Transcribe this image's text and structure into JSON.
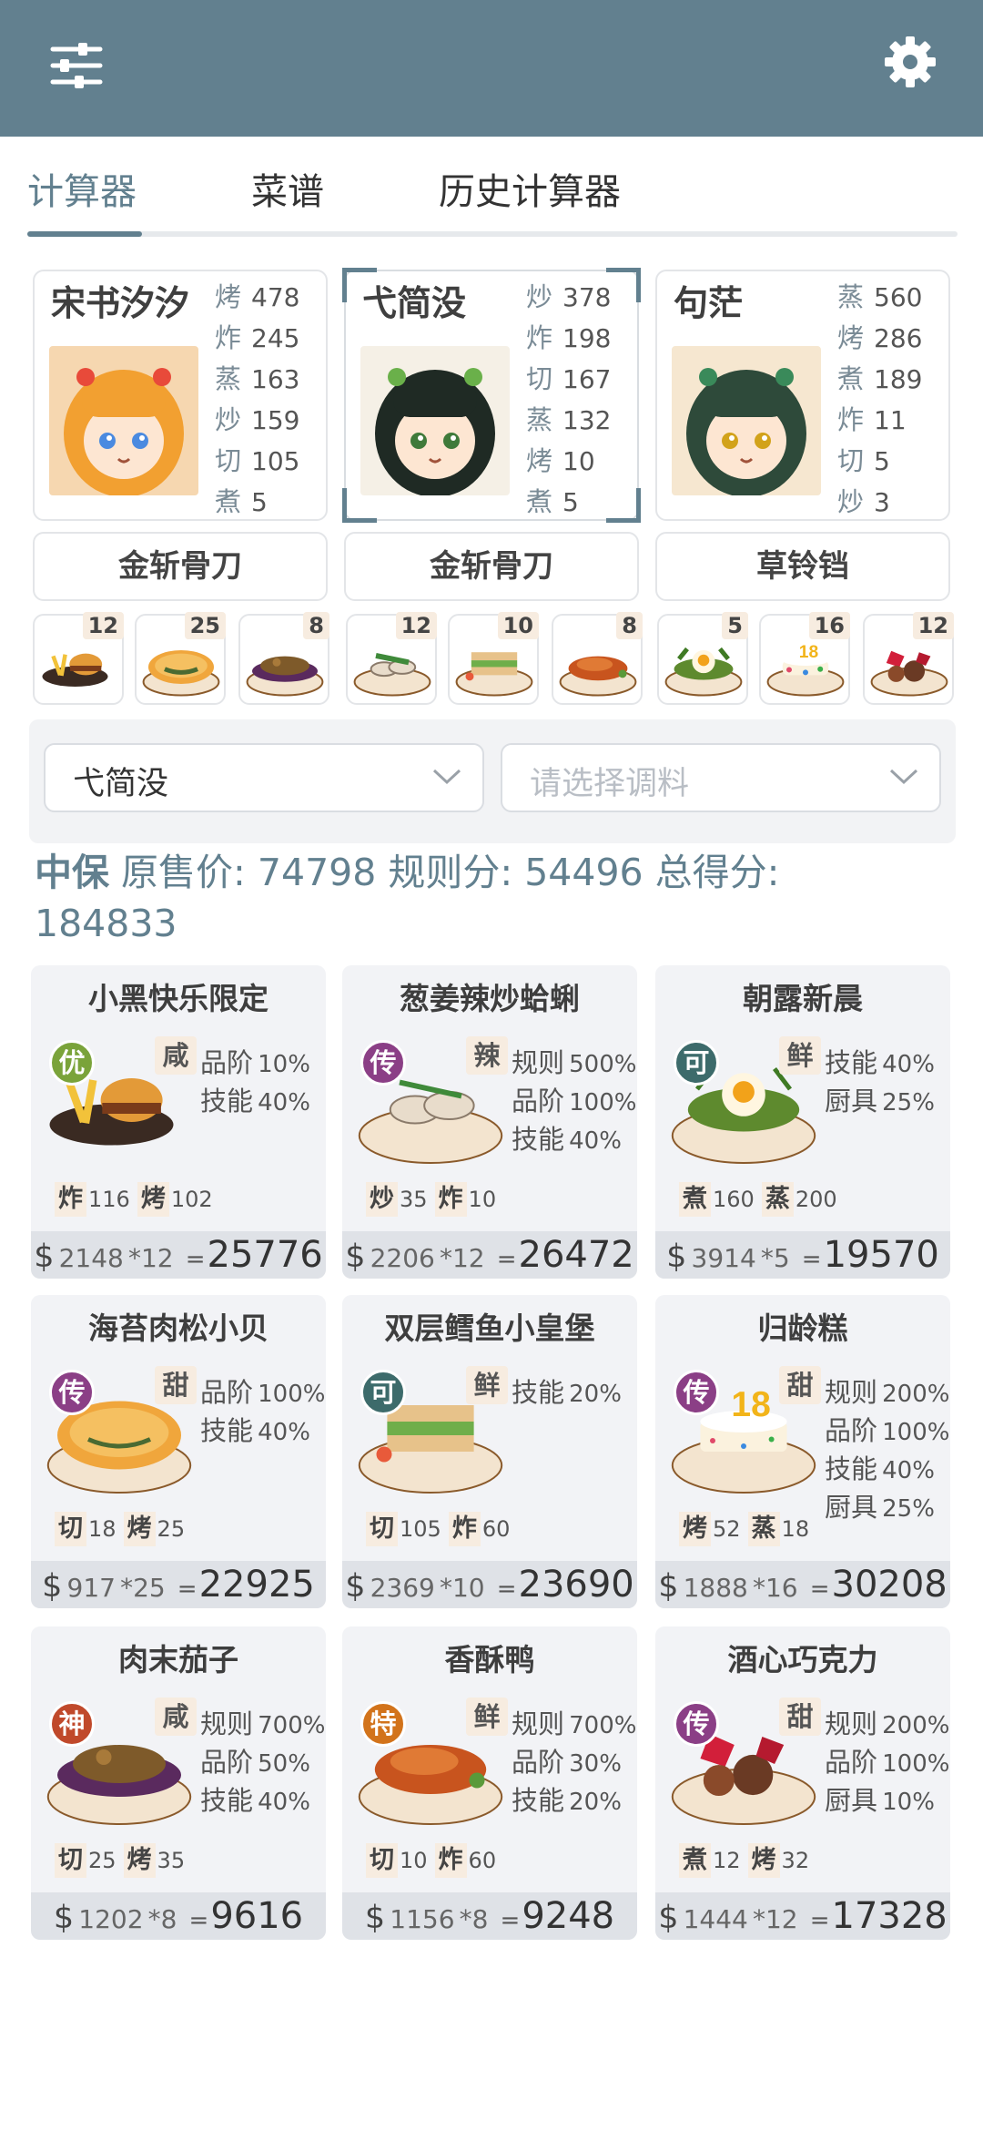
{
  "header": {
    "menu_icon": "sliders-icon",
    "settings_icon": "gear-icon",
    "bg_color": "#62808f"
  },
  "tabs": [
    {
      "label": "计算器",
      "active": true
    },
    {
      "label": "菜谱",
      "active": false
    },
    {
      "label": "历史计算器",
      "active": false
    }
  ],
  "chefs": [
    {
      "name": "宋书汐汐",
      "selected": false,
      "stats": [
        {
          "k": "烤",
          "v": "478"
        },
        {
          "k": "炸",
          "v": "245"
        },
        {
          "k": "蒸",
          "v": "163"
        },
        {
          "k": "炒",
          "v": "159"
        },
        {
          "k": "切",
          "v": "105"
        },
        {
          "k": "煮",
          "v": "5"
        }
      ],
      "tool": "金斩骨刀"
    },
    {
      "name": "弋简没",
      "selected": true,
      "stats": [
        {
          "k": "炒",
          "v": "378"
        },
        {
          "k": "炸",
          "v": "198"
        },
        {
          "k": "切",
          "v": "167"
        },
        {
          "k": "蒸",
          "v": "132"
        },
        {
          "k": "烤",
          "v": "10"
        },
        {
          "k": "煮",
          "v": "5"
        }
      ],
      "tool": "金斩骨刀"
    },
    {
      "name": "句茫",
      "selected": false,
      "stats": [
        {
          "k": "蒸",
          "v": "560"
        },
        {
          "k": "烤",
          "v": "286"
        },
        {
          "k": "煮",
          "v": "189"
        },
        {
          "k": "炸",
          "v": "11"
        },
        {
          "k": "切",
          "v": "5"
        },
        {
          "k": "炒",
          "v": "3"
        }
      ],
      "tool": "草铃铛"
    }
  ],
  "recipe_thumbs": [
    {
      "qty": "12",
      "icon": "burger-fries-icon"
    },
    {
      "qty": "25",
      "icon": "seaweed-shell-icon"
    },
    {
      "qty": "8",
      "icon": "eggplant-icon"
    },
    {
      "qty": "12",
      "icon": "clam-stirfry-icon"
    },
    {
      "qty": "10",
      "icon": "sandwich-icon"
    },
    {
      "qty": "8",
      "icon": "roast-duck-icon"
    },
    {
      "qty": "5",
      "icon": "salad-egg-icon"
    },
    {
      "qty": "16",
      "icon": "birthday-cake-icon"
    },
    {
      "qty": "12",
      "icon": "chocolate-icon"
    }
  ],
  "selects": {
    "chef_value": "弋简没",
    "seasoning_placeholder": "请选择调料"
  },
  "summary": {
    "tier": "中保",
    "line": "原售价: 74798 规则分: 54496 总得分:",
    "total": "184833"
  },
  "dishes": [
    {
      "name": "小黑快乐限定",
      "rarity": "优",
      "rarity_color": "#7aa33a",
      "flavor": "咸",
      "bonuses": [
        {
          "k": "品阶",
          "v": "10%"
        },
        {
          "k": "技能",
          "v": "40%"
        }
      ],
      "reqs": [
        {
          "k": "炸",
          "v": "116"
        },
        {
          "k": "烤",
          "v": "102"
        }
      ],
      "price": "2148",
      "mult": "*12",
      "total": "25776",
      "art": "burger-fries-icon"
    },
    {
      "name": "葱姜辣炒蛤蜊",
      "rarity": "传",
      "rarity_color": "#8b3f86",
      "flavor": "辣",
      "bonuses": [
        {
          "k": "规则",
          "v": "500%"
        },
        {
          "k": "品阶",
          "v": "100%"
        },
        {
          "k": "技能",
          "v": "40%"
        }
      ],
      "reqs": [
        {
          "k": "炒",
          "v": "35"
        },
        {
          "k": "炸",
          "v": "10"
        }
      ],
      "price": "2206",
      "mult": "*12",
      "total": "26472",
      "art": "clam-stirfry-icon"
    },
    {
      "name": "朝露新晨",
      "rarity": "可",
      "rarity_color": "#3d6b6b",
      "flavor": "鲜",
      "bonuses": [
        {
          "k": "技能",
          "v": "40%"
        },
        {
          "k": "厨具",
          "v": "25%"
        }
      ],
      "reqs": [
        {
          "k": "煮",
          "v": "160"
        },
        {
          "k": "蒸",
          "v": "200"
        }
      ],
      "price": "3914",
      "mult": "*5",
      "total": "19570",
      "art": "salad-egg-icon"
    },
    {
      "name": "海苔肉松小贝",
      "rarity": "传",
      "rarity_color": "#8b3f86",
      "flavor": "甜",
      "bonuses": [
        {
          "k": "品阶",
          "v": "100%"
        },
        {
          "k": "技能",
          "v": "40%"
        }
      ],
      "reqs": [
        {
          "k": "切",
          "v": "18"
        },
        {
          "k": "烤",
          "v": "25"
        }
      ],
      "price": "917",
      "mult": "*25",
      "total": "22925",
      "art": "seaweed-shell-icon"
    },
    {
      "name": "双层鳕鱼小皇堡",
      "rarity": "可",
      "rarity_color": "#3d6b6b",
      "flavor": "鲜",
      "bonuses": [
        {
          "k": "技能",
          "v": "20%"
        }
      ],
      "reqs": [
        {
          "k": "切",
          "v": "105"
        },
        {
          "k": "炸",
          "v": "60"
        }
      ],
      "price": "2369",
      "mult": "*10",
      "total": "23690",
      "art": "sandwich-icon"
    },
    {
      "name": "归龄糕",
      "rarity": "传",
      "rarity_color": "#8b3f86",
      "flavor": "甜",
      "bonuses": [
        {
          "k": "规则",
          "v": "200%"
        },
        {
          "k": "品阶",
          "v": "100%"
        },
        {
          "k": "技能",
          "v": "40%"
        },
        {
          "k": "厨具",
          "v": "25%"
        }
      ],
      "reqs": [
        {
          "k": "烤",
          "v": "52"
        },
        {
          "k": "蒸",
          "v": "18"
        }
      ],
      "price": "1888",
      "mult": "*16",
      "total": "30208",
      "art": "birthday-cake-icon"
    },
    {
      "name": "肉末茄子",
      "rarity": "神",
      "rarity_color": "#c0492b",
      "flavor": "咸",
      "bonuses": [
        {
          "k": "规则",
          "v": "700%"
        },
        {
          "k": "品阶",
          "v": "50%"
        },
        {
          "k": "技能",
          "v": "40%"
        }
      ],
      "reqs": [
        {
          "k": "切",
          "v": "25"
        },
        {
          "k": "烤",
          "v": "35"
        }
      ],
      "price": "1202",
      "mult": "*8",
      "total": "9616",
      "art": "eggplant-icon"
    },
    {
      "name": "香酥鸭",
      "rarity": "特",
      "rarity_color": "#d2731b",
      "flavor": "鲜",
      "bonuses": [
        {
          "k": "规则",
          "v": "700%"
        },
        {
          "k": "品阶",
          "v": "30%"
        },
        {
          "k": "技能",
          "v": "20%"
        }
      ],
      "reqs": [
        {
          "k": "切",
          "v": "10"
        },
        {
          "k": "炸",
          "v": "60"
        }
      ],
      "price": "1156",
      "mult": "*8",
      "total": "9248",
      "art": "roast-duck-icon"
    },
    {
      "name": "酒心巧克力",
      "rarity": "传",
      "rarity_color": "#8b3f86",
      "flavor": "甜",
      "bonuses": [
        {
          "k": "规则",
          "v": "200%"
        },
        {
          "k": "品阶",
          "v": "100%"
        },
        {
          "k": "厨具",
          "v": "10%"
        }
      ],
      "reqs": [
        {
          "k": "煮",
          "v": "12"
        },
        {
          "k": "烤",
          "v": "32"
        }
      ],
      "price": "1444",
      "mult": "*12",
      "total": "17328",
      "art": "chocolate-icon"
    }
  ],
  "currency_symbol": "$",
  "equals": "="
}
